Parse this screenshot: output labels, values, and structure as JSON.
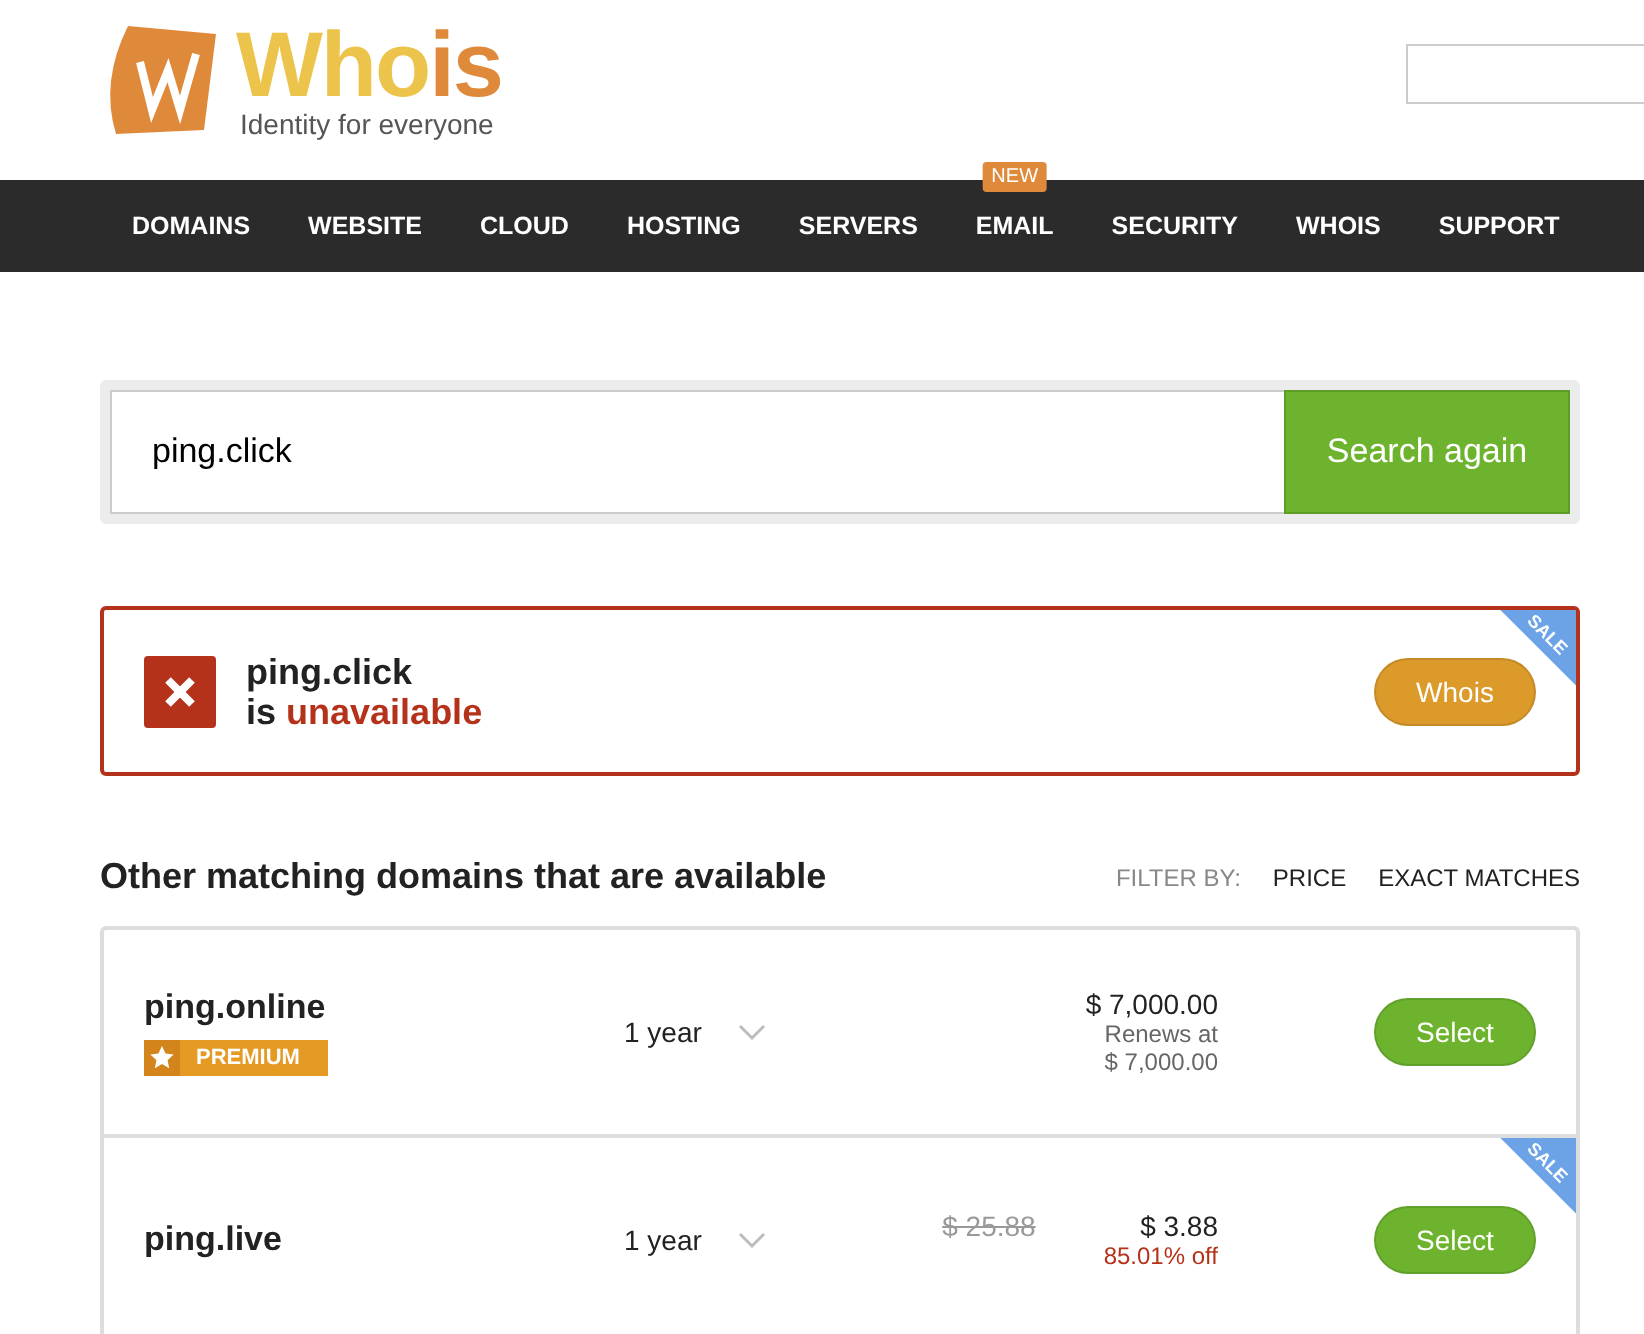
{
  "logo": {
    "parts": [
      {
        "text": "Who",
        "color": "#ecc44c"
      },
      {
        "text": "is",
        "color": "#df8a3a"
      }
    ],
    "tagline": "Identity for everyone"
  },
  "nav": [
    {
      "label": "DOMAINS"
    },
    {
      "label": "WEBSITE"
    },
    {
      "label": "CLOUD"
    },
    {
      "label": "HOSTING"
    },
    {
      "label": "SERVERS"
    },
    {
      "label": "EMAIL",
      "badge": "NEW"
    },
    {
      "label": "SECURITY"
    },
    {
      "label": "WHOIS"
    },
    {
      "label": "SUPPORT"
    }
  ],
  "search": {
    "value": "ping.click",
    "button": "Search again"
  },
  "result": {
    "domain": "ping.click",
    "prefix": "is",
    "status": "unavailable",
    "available": false,
    "button": "Whois",
    "ribbon": "SALE"
  },
  "others": {
    "title": "Other matching domains that are available",
    "filter_label": "FILTER BY:",
    "filters": [
      "PRICE",
      "EXACT MATCHES"
    ],
    "rows": [
      {
        "domain": "ping.online",
        "badge": "PREMIUM",
        "term": "1 year",
        "price": "$ 7,000.00",
        "renew_label": "Renews at",
        "renew_price": "$ 7,000.00",
        "button": "Select"
      },
      {
        "domain": "ping.live",
        "term": "1 year",
        "old_price": "$ 25.88",
        "price": "$ 3.88",
        "discount": "85.01% off",
        "button": "Select",
        "ribbon": "SALE"
      }
    ]
  }
}
